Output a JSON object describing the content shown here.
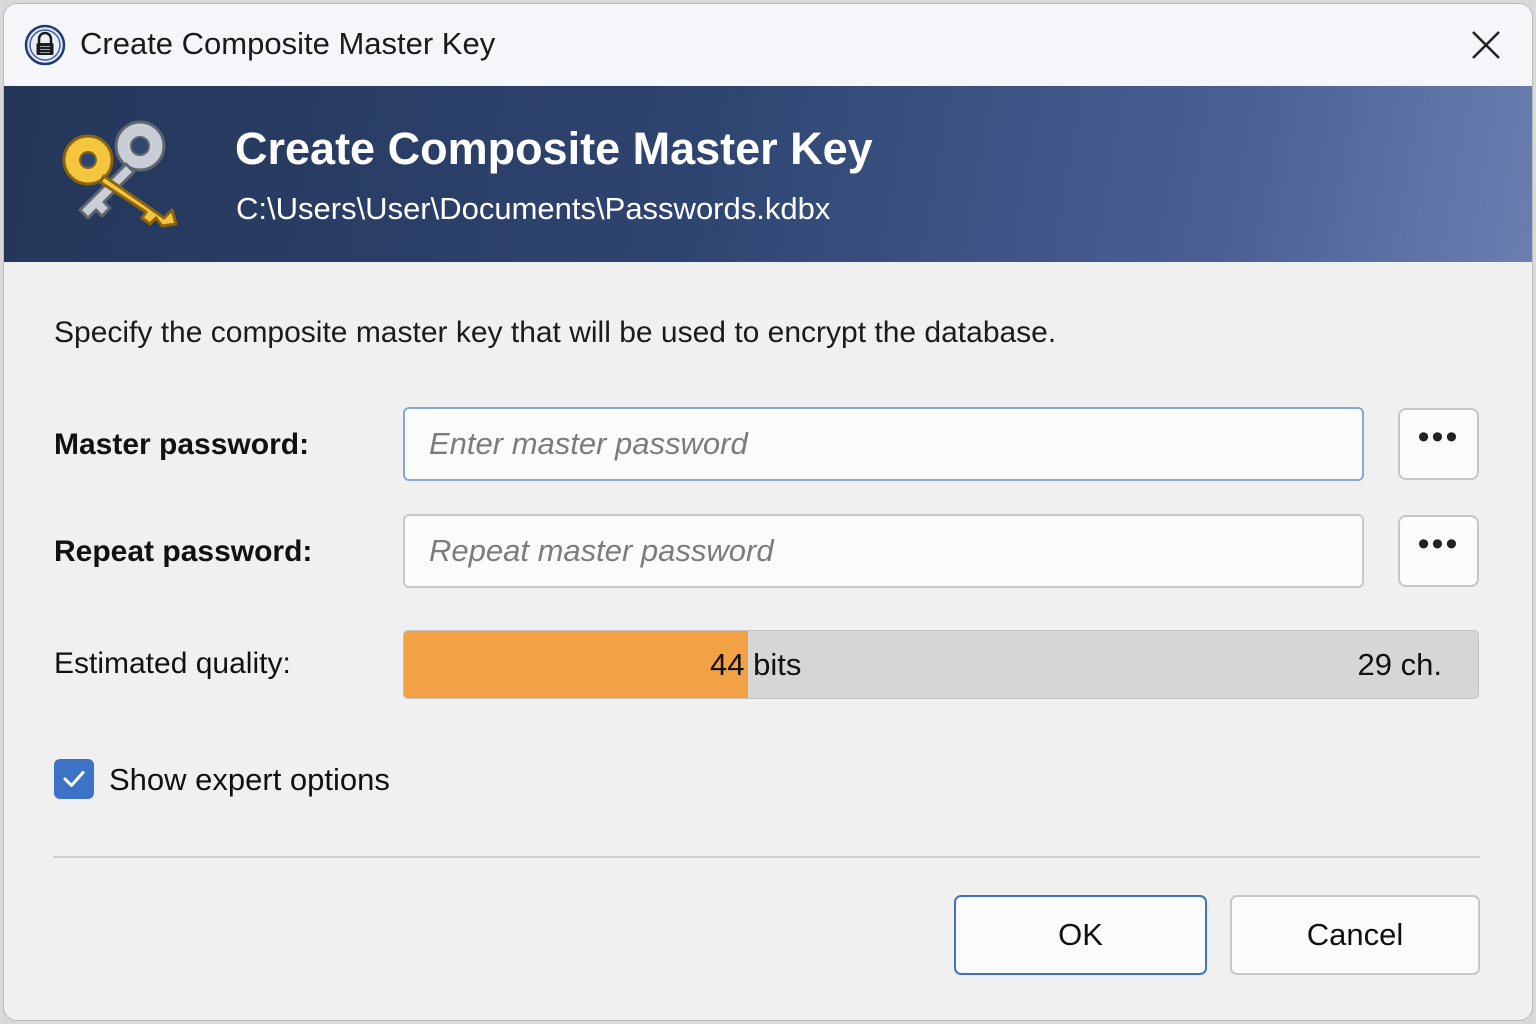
{
  "window": {
    "title": "Create Composite Master Key"
  },
  "banner": {
    "title": "Create Composite Master Key",
    "path": "C:\\Users\\User\\Documents\\Passwords.kdbx"
  },
  "instruction": "Specify the composite master key that will be used to encrypt the database.",
  "fields": {
    "master": {
      "label": "Master password:",
      "value": "",
      "placeholder": "Enter master password",
      "reveal_label": "•••"
    },
    "repeat": {
      "label": "Repeat password:",
      "value": "",
      "placeholder": "Repeat master password",
      "reveal_label": "•••"
    }
  },
  "quality": {
    "label": "Estimated quality:",
    "bits_text": "44 bits",
    "chars_text": "29 ch.",
    "fill_fraction": 0.32,
    "fill_color": "#f2a144"
  },
  "expert": {
    "label": "Show expert options",
    "checked": true
  },
  "buttons": {
    "ok": "OK",
    "cancel": "Cancel"
  },
  "colors": {
    "accent": "#3c73c7",
    "banner_start": "#243659",
    "banner_end": "#6a7fb0"
  },
  "icons": {
    "title": "lock-icon",
    "banner": "keys-icon",
    "close": "close-icon",
    "check": "checkmark-icon"
  }
}
